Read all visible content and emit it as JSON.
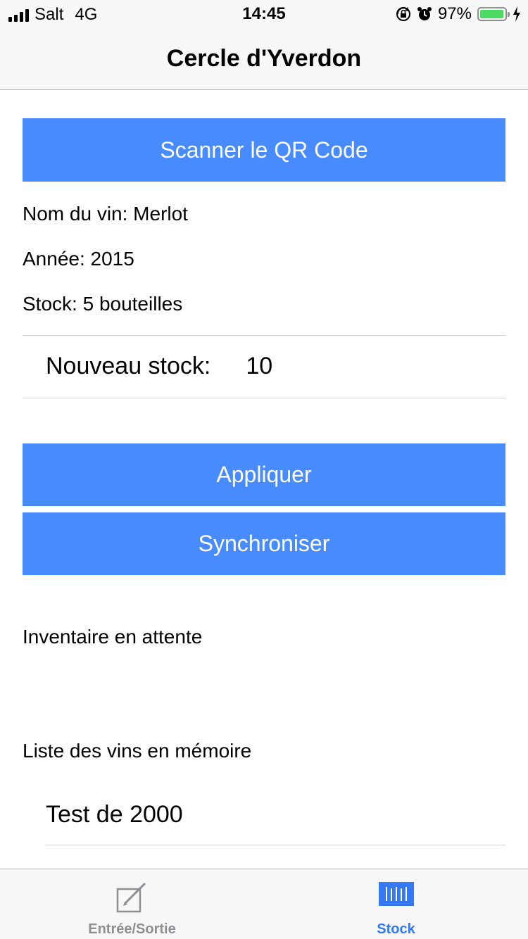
{
  "status_bar": {
    "carrier": "Salt",
    "network": "4G",
    "time": "14:45",
    "battery_percent_label": "97%",
    "battery_level": 0.97,
    "icons": [
      "signal-icon",
      "orientation-lock-icon",
      "alarm-icon",
      "battery-icon",
      "charging-bolt-icon"
    ]
  },
  "nav": {
    "title": "Cercle d'Yverdon"
  },
  "main": {
    "scan_button_label": "Scanner le QR Code",
    "wine_name": "Nom du vin: Merlot",
    "year": "Année: 2015",
    "stock": "Stock: 5 bouteilles",
    "new_stock_label": "Nouveau stock:",
    "new_stock_value": "10",
    "apply_button_label": "Appliquer",
    "sync_button_label": "Synchroniser",
    "pending_inventory_label": "Inventaire en attente",
    "wine_memory_label": "Liste des vins en mémoire",
    "wine_list": [
      "Test de 2000"
    ]
  },
  "tab_bar": {
    "tabs": [
      {
        "label": "Entrée/Sortie",
        "icon": "compose-icon",
        "selected": false
      },
      {
        "label": "Stock",
        "icon": "barcode-icon",
        "selected": true
      }
    ]
  },
  "colors": {
    "accent": "#478bff",
    "tab_selected": "#3478f6",
    "tab_unselected": "#8e8e93"
  }
}
